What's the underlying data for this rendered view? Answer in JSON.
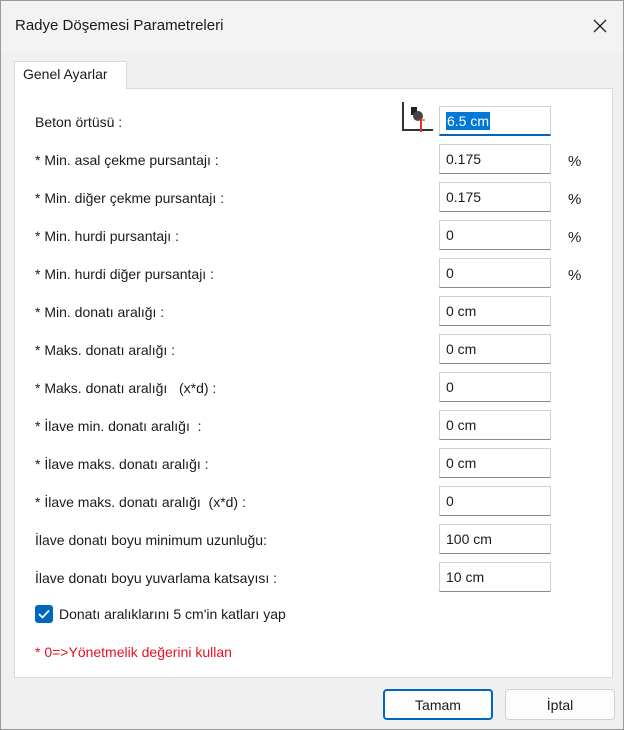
{
  "window": {
    "title": "Radye Döşemesi Parametreleri"
  },
  "tab": {
    "label": "Genel Ayarlar"
  },
  "rows": [
    {
      "label": "Beton örtüsü :",
      "value": "6.5 cm",
      "unit": ""
    },
    {
      "label": "* Min. asal çekme pursantajı :",
      "value": "0.175",
      "unit": "%"
    },
    {
      "label": "* Min. diğer çekme pursantajı :",
      "value": "0.175",
      "unit": "%"
    },
    {
      "label": "* Min. hurdi pursantajı :",
      "value": "0",
      "unit": "%"
    },
    {
      "label": "* Min. hurdi diğer pursantajı :",
      "value": "0",
      "unit": "%"
    },
    {
      "label": "* Min. donatı aralığı :",
      "value": "0 cm",
      "unit": ""
    },
    {
      "label": "* Maks. donatı aralığı :",
      "value": "0 cm",
      "unit": ""
    },
    {
      "label": "* Maks. donatı aralığı   (x*d) :",
      "value": "0",
      "unit": ""
    },
    {
      "label": "* İlave min. donatı aralığı  :",
      "value": "0 cm",
      "unit": ""
    },
    {
      "label": "* İlave maks. donatı aralığı :",
      "value": "0 cm",
      "unit": ""
    },
    {
      "label": "* İlave maks. donatı aralığı  (x*d) :",
      "value": "0",
      "unit": ""
    },
    {
      "label": "İlave donatı boyu minimum uzunluğu:",
      "value": "100 cm",
      "unit": ""
    },
    {
      "label": "İlave donatı boyu yuvarlama katsayısı :",
      "value": "10 cm",
      "unit": ""
    }
  ],
  "checkbox": {
    "label": "Donatı aralıklarını 5 cm'in katları yap",
    "checked": true
  },
  "note": "* 0=>Yönetmelik değerini kullan",
  "buttons": {
    "ok": "Tamam",
    "cancel": "İptal"
  },
  "colors": {
    "accent": "#0067c0",
    "selection": "#0078d7",
    "note": "#e81123"
  }
}
